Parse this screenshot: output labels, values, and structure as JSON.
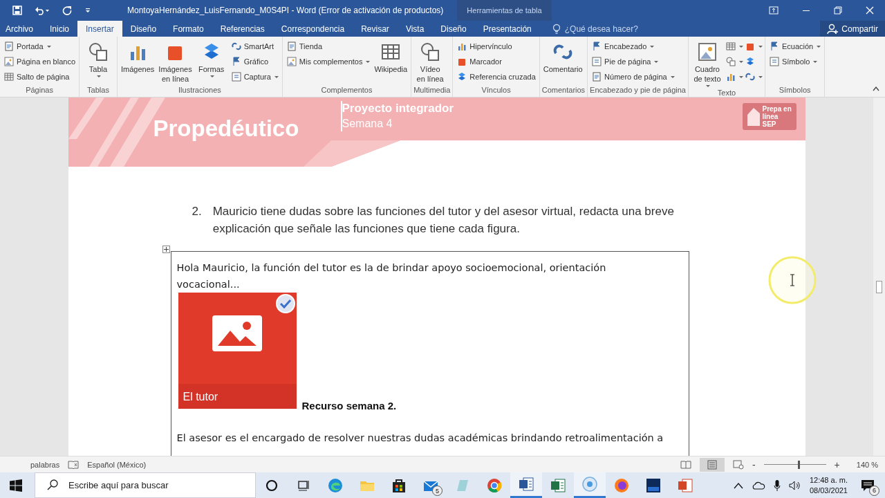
{
  "window": {
    "title": "MontoyaHernández_LuisFernando_M0S4PI - Word (Error de activación de productos)",
    "context_tab": "Herramientas de tabla"
  },
  "tabs": [
    {
      "label": "Archivo",
      "selected": false
    },
    {
      "label": "Inicio",
      "selected": false
    },
    {
      "label": "Insertar",
      "selected": true
    },
    {
      "label": "Diseño",
      "selected": false
    },
    {
      "label": "Formato",
      "selected": false
    },
    {
      "label": "Referencias",
      "selected": false
    },
    {
      "label": "Correspondencia",
      "selected": false
    },
    {
      "label": "Revisar",
      "selected": false
    },
    {
      "label": "Vista",
      "selected": false
    },
    {
      "label": "Diseño",
      "selected": false
    },
    {
      "label": "Presentación",
      "selected": false
    }
  ],
  "tell_me": {
    "placeholder": "¿Qué desea hacer?"
  },
  "share": "Compartir",
  "ribbon": [
    {
      "name": "Páginas",
      "columns": [
        [
          {
            "label": "Portada",
            "dropdown": true,
            "kind": "small"
          },
          {
            "label": "Página en blanco",
            "dropdown": false,
            "kind": "small"
          },
          {
            "label": "Salto de página",
            "dropdown": false,
            "kind": "small"
          }
        ]
      ]
    },
    {
      "name": "Tablas",
      "columns": [
        [
          {
            "label": "Tabla",
            "dropdown": true,
            "kind": "large"
          }
        ]
      ]
    },
    {
      "name": "Ilustraciones",
      "columns": [
        [
          {
            "label": "Imágenes",
            "dropdown": false,
            "kind": "large"
          }
        ],
        [
          {
            "label": "Imágenes en línea",
            "dropdown": false,
            "kind": "large"
          }
        ],
        [
          {
            "label": "Formas",
            "dropdown": true,
            "kind": "large"
          }
        ],
        [
          {
            "label": "SmartArt",
            "dropdown": false,
            "kind": "small"
          },
          {
            "label": "Gráfico",
            "dropdown": false,
            "kind": "small"
          },
          {
            "label": "Captura",
            "dropdown": true,
            "kind": "small"
          }
        ]
      ]
    },
    {
      "name": "Complementos",
      "columns": [
        [
          {
            "label": "Tienda",
            "dropdown": false,
            "kind": "small"
          },
          {
            "label": "Mis complementos",
            "dropdown": true,
            "kind": "small"
          }
        ],
        [
          {
            "label": "Wikipedia",
            "dropdown": false,
            "kind": "large"
          }
        ]
      ]
    },
    {
      "name": "Multimedia",
      "columns": [
        [
          {
            "label": "Vídeo en línea",
            "dropdown": false,
            "kind": "large"
          }
        ]
      ]
    },
    {
      "name": "Vínculos",
      "columns": [
        [
          {
            "label": "Hipervínculo",
            "dropdown": false,
            "kind": "small"
          },
          {
            "label": "Marcador",
            "dropdown": false,
            "kind": "small"
          },
          {
            "label": "Referencia cruzada",
            "dropdown": false,
            "kind": "small"
          }
        ]
      ]
    },
    {
      "name": "Comentarios",
      "columns": [
        [
          {
            "label": "Comentario",
            "dropdown": false,
            "kind": "large"
          }
        ]
      ]
    },
    {
      "name": "Encabezado y pie de página",
      "columns": [
        [
          {
            "label": "Encabezado",
            "dropdown": true,
            "kind": "small"
          },
          {
            "label": "Pie de página",
            "dropdown": true,
            "kind": "small"
          },
          {
            "label": "Número de página",
            "dropdown": true,
            "kind": "small"
          }
        ]
      ]
    },
    {
      "name": "Texto",
      "columns": [
        [
          {
            "label": "Cuadro de texto",
            "dropdown": true,
            "kind": "large"
          }
        ],
        [
          {
            "dropdown": true,
            "kind": "icon"
          },
          {
            "dropdown": true,
            "kind": "icon"
          },
          {
            "dropdown": true,
            "kind": "icon"
          }
        ],
        [
          {
            "dropdown": true,
            "kind": "icon"
          },
          {
            "dropdown": false,
            "kind": "icon"
          },
          {
            "dropdown": true,
            "kind": "icon"
          }
        ]
      ]
    },
    {
      "name": "Símbolos",
      "columns": [
        [
          {
            "label": "Ecuación",
            "dropdown": true,
            "kind": "small"
          },
          {
            "label": "Símbolo",
            "dropdown": true,
            "kind": "small"
          }
        ]
      ]
    }
  ],
  "document": {
    "banner": {
      "title": "Propedéutico",
      "subtitle": "Proyecto integrador",
      "week": "Semana 4",
      "logo": "Prepa en línea SEP"
    },
    "question": {
      "number": "2.",
      "text": "Mauricio tiene dudas sobre las funciones del tutor y del asesor virtual, redacta una breve explicación que señale las funciones que tiene cada figura."
    },
    "answer": {
      "intro": "Hola Mauricio, la función del tutor es la de brindar apoyo socioemocional, orientación vocacional...",
      "image_caption": "El tutor",
      "resource": "Recurso semana 2.",
      "advisor": "El asesor es el encargado de resolver nuestras dudas académicas brindando retroalimentación a"
    }
  },
  "status_bar": {
    "words": "palabras",
    "language": "Español (México)",
    "zoom": {
      "level": 0.56,
      "reading": "140 %",
      "zoom_out": "-",
      "zoom_in": "+"
    }
  },
  "taskbar": {
    "search": {
      "placeholder": "Escribe aquí para buscar"
    },
    "apps": [
      {
        "kind": "cortana",
        "active": false
      },
      {
        "kind": "taskview",
        "active": false
      },
      {
        "kind": "edge",
        "active": false
      },
      {
        "kind": "folder",
        "active": false
      },
      {
        "kind": "store",
        "active": false
      },
      {
        "kind": "mail",
        "active": false,
        "badge": "5"
      },
      {
        "kind": "notes",
        "active": false
      },
      {
        "kind": "chrome",
        "active": false
      },
      {
        "kind": "word",
        "active": true
      },
      {
        "kind": "excel",
        "active": false
      },
      {
        "kind": "recorder",
        "active": true
      },
      {
        "kind": "firefox",
        "active": false
      },
      {
        "kind": "dev",
        "active": false
      },
      {
        "kind": "powerpoint",
        "active": false
      }
    ],
    "time": "12:48 a. m.",
    "date": "08/03/2021",
    "notifications": "6"
  }
}
